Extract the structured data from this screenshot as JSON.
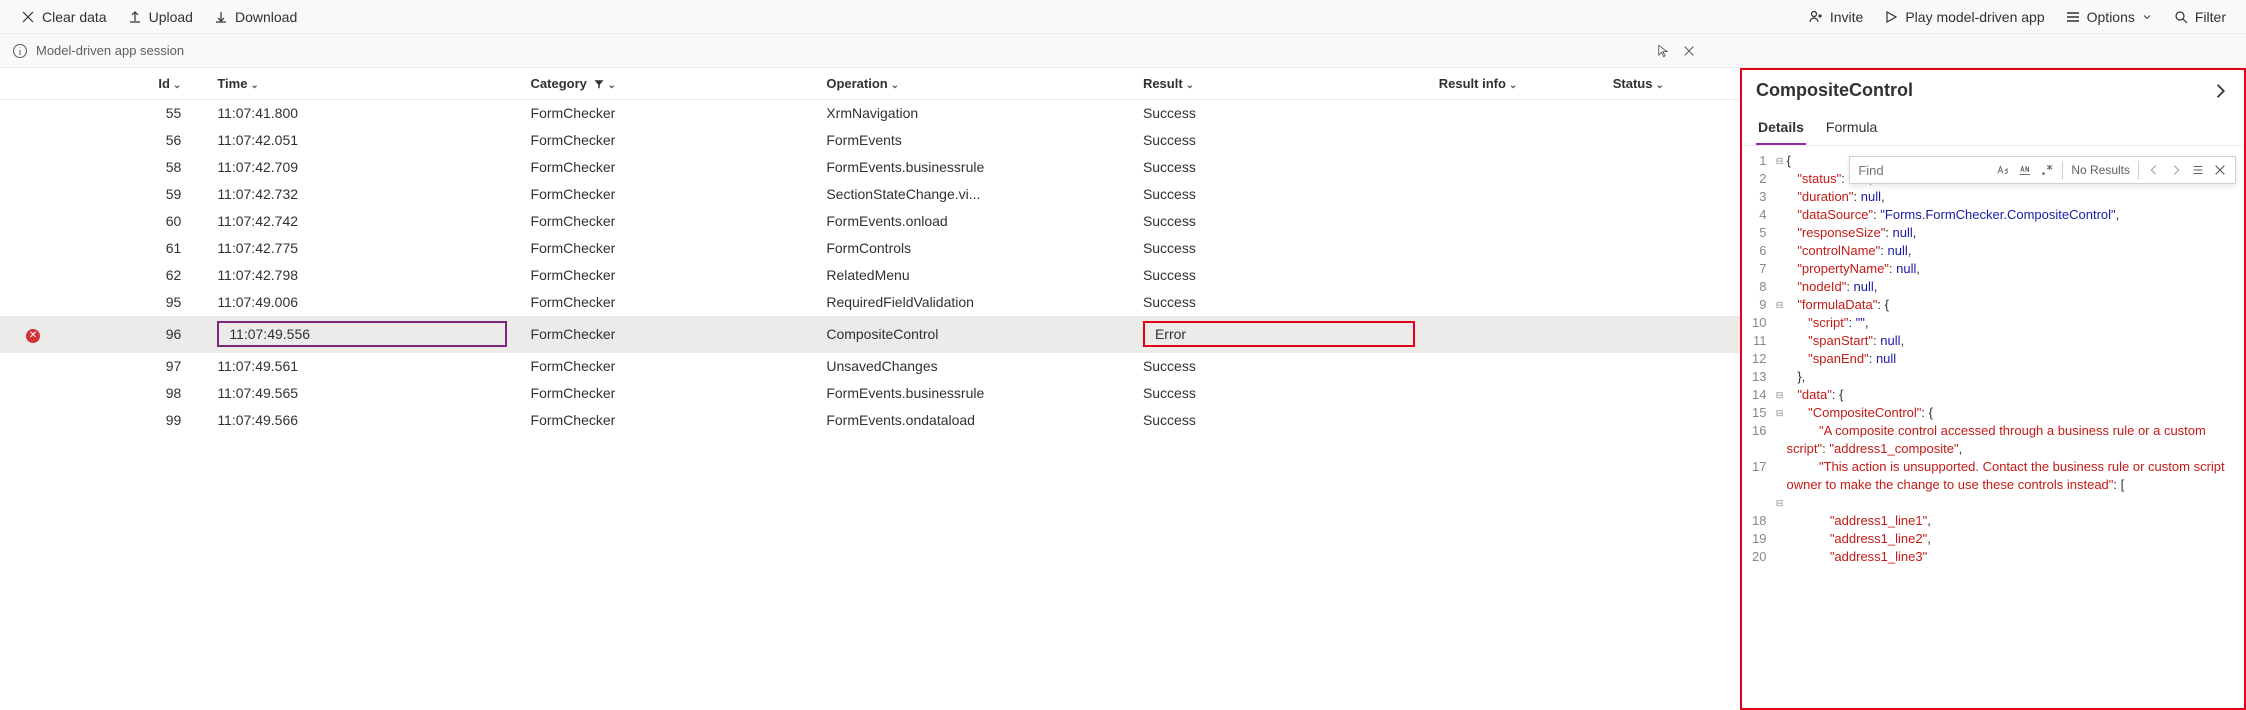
{
  "toolbar": {
    "clear": "Clear data",
    "upload": "Upload",
    "download": "Download",
    "invite": "Invite",
    "play": "Play model-driven app",
    "options": "Options",
    "filter": "Filter"
  },
  "session": {
    "label": "Model-driven app session"
  },
  "columns": {
    "id": "Id",
    "time": "Time",
    "category": "Category",
    "operation": "Operation",
    "result": "Result",
    "resultinfo": "Result info",
    "status": "Status"
  },
  "rows": [
    {
      "id": "55",
      "time": "11:07:41.800",
      "category": "FormChecker",
      "operation": "XrmNavigation",
      "result": "Success",
      "error": false
    },
    {
      "id": "56",
      "time": "11:07:42.051",
      "category": "FormChecker",
      "operation": "FormEvents",
      "result": "Success",
      "error": false
    },
    {
      "id": "58",
      "time": "11:07:42.709",
      "category": "FormChecker",
      "operation": "FormEvents.businessrule",
      "result": "Success",
      "error": false
    },
    {
      "id": "59",
      "time": "11:07:42.732",
      "category": "FormChecker",
      "operation": "SectionStateChange.vi...",
      "result": "Success",
      "error": false
    },
    {
      "id": "60",
      "time": "11:07:42.742",
      "category": "FormChecker",
      "operation": "FormEvents.onload",
      "result": "Success",
      "error": false
    },
    {
      "id": "61",
      "time": "11:07:42.775",
      "category": "FormChecker",
      "operation": "FormControls",
      "result": "Success",
      "error": false
    },
    {
      "id": "62",
      "time": "11:07:42.798",
      "category": "FormChecker",
      "operation": "RelatedMenu",
      "result": "Success",
      "error": false
    },
    {
      "id": "95",
      "time": "11:07:49.006",
      "category": "FormChecker",
      "operation": "RequiredFieldValidation",
      "result": "Success",
      "error": false
    },
    {
      "id": "96",
      "time": "11:07:49.556",
      "category": "FormChecker",
      "operation": "CompositeControl",
      "result": "Error",
      "error": true
    },
    {
      "id": "97",
      "time": "11:07:49.561",
      "category": "FormChecker",
      "operation": "UnsavedChanges",
      "result": "Success",
      "error": false
    },
    {
      "id": "98",
      "time": "11:07:49.565",
      "category": "FormChecker",
      "operation": "FormEvents.businessrule",
      "result": "Success",
      "error": false
    },
    {
      "id": "99",
      "time": "11:07:49.566",
      "category": "FormChecker",
      "operation": "FormEvents.ondataload",
      "result": "Success",
      "error": false
    }
  ],
  "details": {
    "title": "CompositeControl",
    "tabs": {
      "details": "Details",
      "formula": "Formula"
    },
    "find": {
      "placeholder": "Find",
      "noresults": "No Results"
    },
    "json": {
      "status": null,
      "duration": null,
      "dataSource": "Forms.FormChecker.CompositeControl",
      "responseSize": null,
      "controlName": null,
      "propertyName": null,
      "nodeId": null,
      "formulaData": {
        "script": "",
        "spanStart": null,
        "spanEnd": null
      },
      "data": {
        "CompositeControl": {
          "A composite control accessed through a business rule or a custom script": "address1_composite",
          "This action is unsupported. Contact the business rule or custom script owner to make the change to use these controls instead": [
            "address1_line1",
            "address1_line2",
            "address1_line3"
          ]
        }
      }
    },
    "code_lines": [
      {
        "n": 1,
        "fold": "⊟",
        "html": "<span class='p'>{</span>"
      },
      {
        "n": 2,
        "fold": "",
        "html": "   <span class='k'>\"status\"</span><span class='p'>: </span><span class='u'>null</span><span class='p'>,</span>"
      },
      {
        "n": 3,
        "fold": "",
        "html": "   <span class='k'>\"duration\"</span><span class='p'>: </span><span class='u'>null</span><span class='p'>,</span>"
      },
      {
        "n": 4,
        "fold": "",
        "html": "   <span class='k'>\"dataSource\"</span><span class='p'>: </span><span class='s'>\"Forms.FormChecker.CompositeControl\"</span><span class='p'>,</span>"
      },
      {
        "n": 5,
        "fold": "",
        "html": "   <span class='k'>\"responseSize\"</span><span class='p'>: </span><span class='u'>null</span><span class='p'>,</span>"
      },
      {
        "n": 6,
        "fold": "",
        "html": "   <span class='k'>\"controlName\"</span><span class='p'>: </span><span class='u'>null</span><span class='p'>,</span>"
      },
      {
        "n": 7,
        "fold": "",
        "html": "   <span class='k'>\"propertyName\"</span><span class='p'>: </span><span class='u'>null</span><span class='p'>,</span>"
      },
      {
        "n": 8,
        "fold": "",
        "html": "   <span class='k'>\"nodeId\"</span><span class='p'>: </span><span class='u'>null</span><span class='p'>,</span>"
      },
      {
        "n": 9,
        "fold": "⊟",
        "html": "   <span class='k'>\"formulaData\"</span><span class='p'>: {</span>"
      },
      {
        "n": 10,
        "fold": "",
        "html": "      <span class='k'>\"script\"</span><span class='p'>: </span><span class='s'>\"\"</span><span class='p'>,</span>"
      },
      {
        "n": 11,
        "fold": "",
        "html": "      <span class='k'>\"spanStart\"</span><span class='p'>: </span><span class='u'>null</span><span class='p'>,</span>"
      },
      {
        "n": 12,
        "fold": "",
        "html": "      <span class='k'>\"spanEnd\"</span><span class='p'>: </span><span class='u'>null</span>"
      },
      {
        "n": 13,
        "fold": "",
        "html": "   <span class='p'>},</span>"
      },
      {
        "n": 14,
        "fold": "⊟",
        "html": "   <span class='k'>\"data\"</span><span class='p'>: {</span>"
      },
      {
        "n": 15,
        "fold": "⊟",
        "html": "      <span class='err-k'>\"CompositeControl\"</span><span class='p'>: {</span>"
      },
      {
        "n": 16,
        "fold": "",
        "wrap": true,
        "html": "         <span class='err-k'>\"A composite control accessed through a business rule or a custom script\"</span><span class='p'>: </span><span class='err-v'>\"address1_composite\"</span><span class='p'>,</span>"
      },
      {
        "n": 17,
        "fold": "",
        "wrap": true,
        "html": "         <span class='err-k'>\"This action is unsupported. Contact the business rule or custom script owner to make the change to use these controls instead\"</span><span class='p'>: [</span>"
      },
      {
        "n": "",
        "fold": "⊟",
        "html": ""
      },
      {
        "n": 18,
        "fold": "",
        "html": "            <span class='err-v'>\"address1_line1\"</span><span class='p'>,</span>"
      },
      {
        "n": 19,
        "fold": "",
        "html": "            <span class='err-v'>\"address1_line2\"</span><span class='p'>,</span>"
      },
      {
        "n": 20,
        "fold": "",
        "html": "            <span class='err-v'>\"address1_line3\"</span>"
      }
    ]
  }
}
